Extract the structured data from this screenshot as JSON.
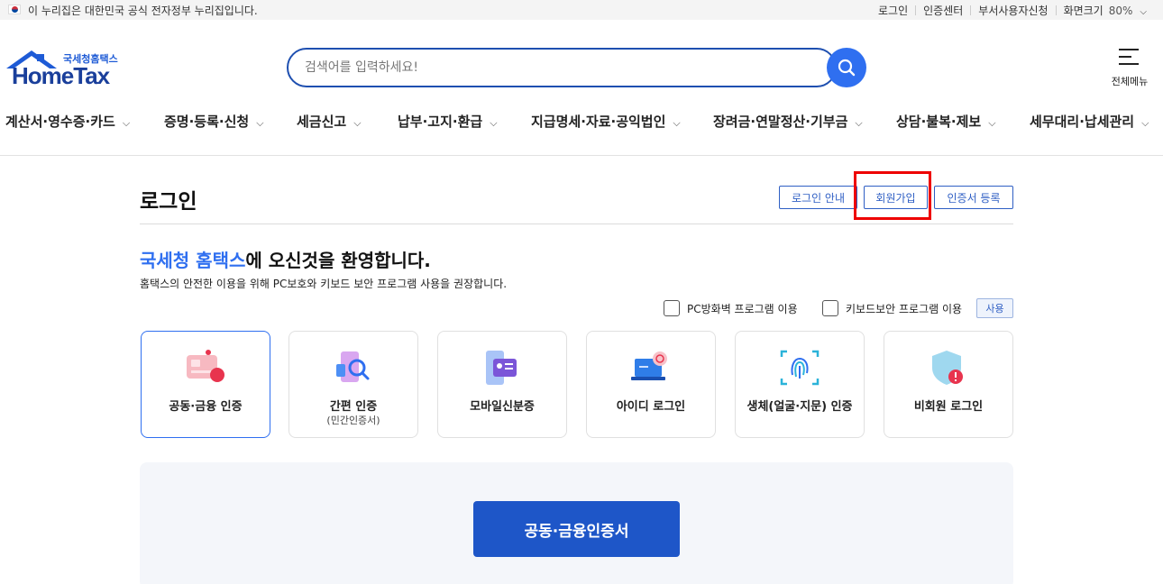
{
  "gov_banner": {
    "text": "이 누리집은 대한민국 공식 전자정부 누리집입니다.",
    "links": [
      "로그인",
      "인증센터",
      "부서사용자신청"
    ],
    "zoom_label": "화면크기",
    "zoom_value": "80%"
  },
  "header": {
    "logo_sub": "국세청홈택스",
    "logo_main": "HomeTax",
    "search_placeholder": "검색어를 입력하세요!",
    "all_menu_label": "전체메뉴"
  },
  "gnb": {
    "items": [
      "계산서·영수증·카드",
      "증명·등록·신청",
      "세금신고",
      "납부·고지·환급",
      "지급명세·자료·공익법인",
      "장려금·연말정산·기부금",
      "상담·불복·제보",
      "세무대리·납세관리"
    ]
  },
  "login": {
    "title": "로그인",
    "buttons": {
      "guide": "로그인 안내",
      "signup": "회원가입",
      "cert_register": "인증서 등록"
    },
    "welcome_accent": "국세청 홈택스",
    "welcome_rest": "에 오신것을 환영합니다.",
    "welcome_sub": "홈택스의 안전한 이용을 위해 PC보호와 키보드 보안 프로그램 사용을 권장합니다.",
    "options": {
      "pc_firewall": "PC방화벽 프로그램 이용",
      "keyboard_security": "키보드보안 프로그램 이용",
      "use_button": "사용"
    },
    "methods": [
      {
        "label": "공동·금융 인증",
        "sub": ""
      },
      {
        "label": "간편 인증",
        "sub": "(민간인증서)"
      },
      {
        "label": "모바일신분증",
        "sub": ""
      },
      {
        "label": "아이디 로그인",
        "sub": ""
      },
      {
        "label": "생체(얼굴·지문) 인증",
        "sub": ""
      },
      {
        "label": "비회원 로그인",
        "sub": ""
      }
    ],
    "cert_button": "공동·금융인증서"
  },
  "colors": {
    "primary": "#2f6ff0",
    "navy": "#1a3f9b",
    "button_blue": "#1e56c8",
    "highlight_red": "#ee0000"
  }
}
